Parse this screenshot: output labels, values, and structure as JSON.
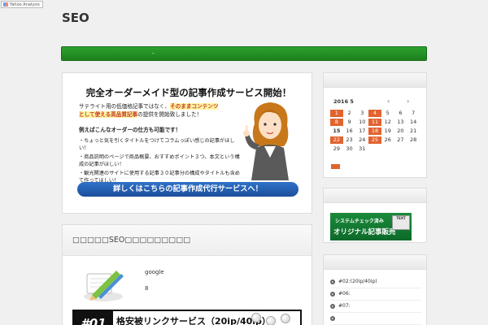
{
  "badge": {
    "text": "Yahoo Analysis"
  },
  "header": {
    "site_title": "SEO"
  },
  "nav": {
    "items": [
      "-"
    ]
  },
  "ad": {
    "title": "完全オーダーメイド型の記事作成サービス開始！",
    "intro_part1": "サテライト用の低価格記事ではなく、",
    "intro_hl1": "そのままコンテンツ",
    "intro_hl2": "として使える高品質記事",
    "intro_part2": "の提供を開始致しました！",
    "example_heading": "例えばこんなオーダーの仕方も可能です！",
    "bullets": [
      "・ちょっと気を引くタイトルをつけてコラムっぽい感じの記事がほしい！",
      "・商品説明のページで商品概要、おすすめポイント３つ、本文という構成の記事がほしい！",
      "・観光関連のサイトに使用する記事３０記事分の構成やタイトルも含めて作ってほしい！"
    ],
    "cta": "詳しくはこちらの記事作成代行サービスへ！"
  },
  "post": {
    "heading": "□□□□□SEO□□□□□□□□□",
    "meta_line1": "google",
    "meta_line2": "8",
    "banner_num": "#01",
    "banner_text": "格安被リンクサービス（20ip/40ip）"
  },
  "calendar": {
    "month_label": "2016 5",
    "prev": "‹",
    "next": "›",
    "days": [
      "1",
      "2",
      "3",
      "4",
      "5",
      "6",
      "7",
      "8",
      "9",
      "10",
      "11",
      "12",
      "13",
      "14",
      "15",
      "16",
      "17",
      "18",
      "19",
      "20",
      "21",
      "22",
      "23",
      "24",
      "25",
      "26",
      "27",
      "28",
      "29",
      "30",
      "31"
    ],
    "highlighted": [
      "1",
      "4",
      "8",
      "11",
      "18",
      "22",
      "25"
    ],
    "today": "15"
  },
  "side_banner": {
    "line1": "システムチェック済み",
    "line2": "オリジナル記事販売",
    "tag": "TEXT"
  },
  "categories": {
    "items": [
      "#02:(20ip/40ip)",
      "#06:",
      "#07:",
      "",
      ""
    ]
  }
}
